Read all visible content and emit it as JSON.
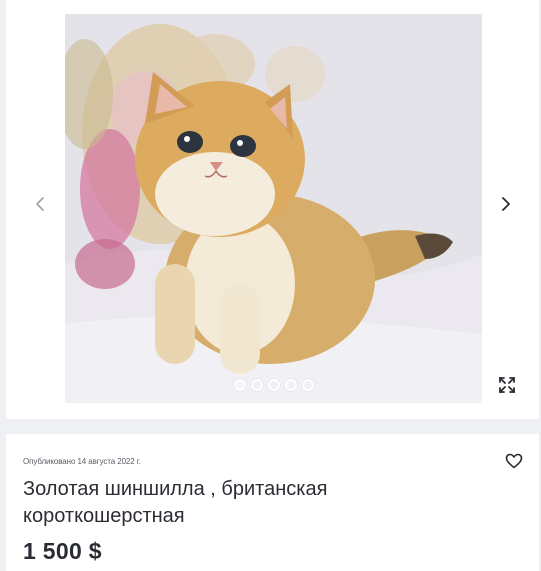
{
  "listing": {
    "published": "Опубликовано 14 августа 2022 г.",
    "title": "Золотая шиншилла , британская короткошерстная",
    "price": "1 500 $"
  },
  "gallery": {
    "image_subject": "golden british shorthair kitten",
    "photo_count": 5,
    "active_index": 0,
    "icons": {
      "prev": "chevron-left-icon",
      "next": "chevron-right-icon",
      "expand": "expand-icon",
      "favorite": "heart-icon"
    }
  },
  "colors": {
    "page_bg": "#eef0f3",
    "card_bg": "#ffffff",
    "text": "#2a2d33"
  }
}
